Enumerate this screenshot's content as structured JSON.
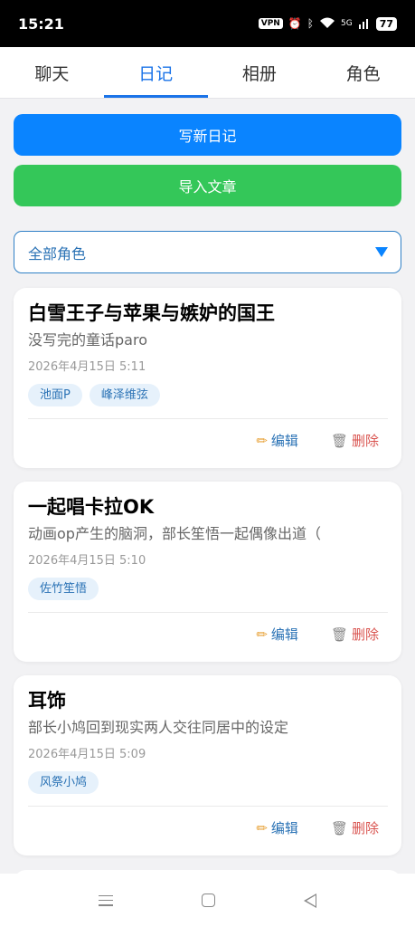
{
  "status": {
    "time": "15:21",
    "vpn": "VPN",
    "network": "5G",
    "battery": "77"
  },
  "tabs": [
    {
      "label": "聊天"
    },
    {
      "label": "日记",
      "active": true
    },
    {
      "label": "相册"
    },
    {
      "label": "角色"
    }
  ],
  "actions": {
    "new_diary": "写新日记",
    "import_article": "导入文章"
  },
  "role_filter": {
    "selected": "全部角色"
  },
  "diaries": [
    {
      "title": "白雪王子与苹果与嫉妒的国王",
      "desc": "没写完的童话paro",
      "date": "2026年4月15日 5:11",
      "tags": [
        "池面P",
        "峰泽维弦"
      ]
    },
    {
      "title": "一起唱卡拉OK",
      "desc": "动画op产生的脑洞，部长笙悟一起偶像出道（",
      "date": "2026年4月15日 5:10",
      "tags": [
        "佐竹笙悟"
      ]
    },
    {
      "title": "耳饰",
      "desc": "部长小鸠回到现实两人交往同居中的设定",
      "date": "2026年4月15日 5:09",
      "tags": [
        "风祭小鸠"
      ]
    }
  ],
  "card_actions": {
    "edit": "编辑",
    "delete": "删除"
  },
  "colors": {
    "primary": "#0a84ff",
    "success": "#34c759",
    "accent_text": "#2a72b5",
    "danger": "#d9534f"
  }
}
